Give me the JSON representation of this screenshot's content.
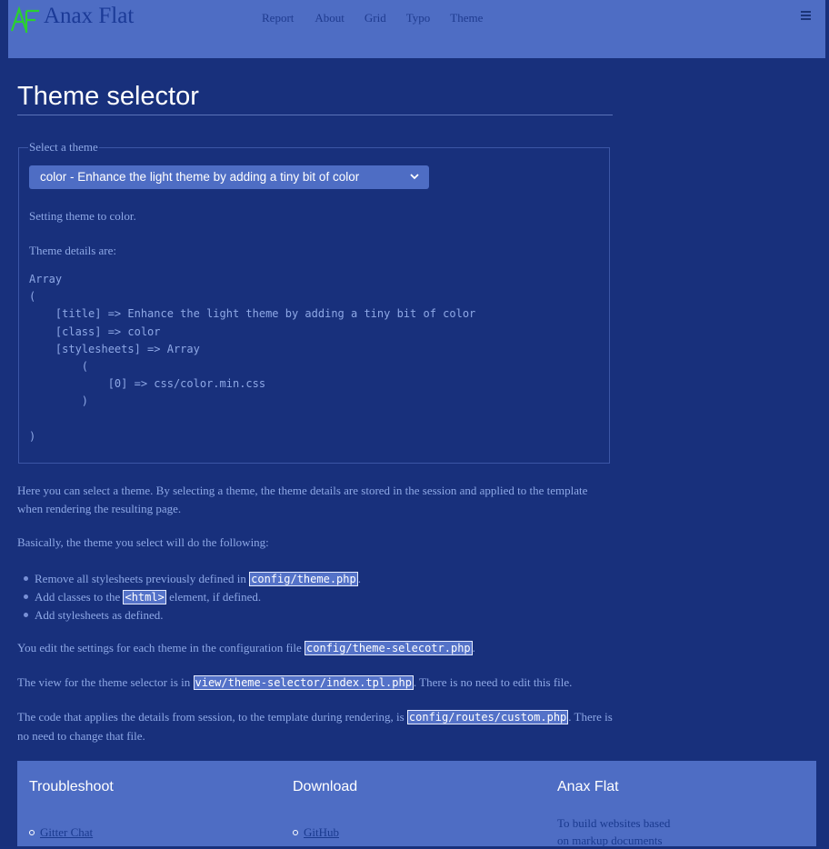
{
  "header": {
    "site_title": "Anax Flat",
    "nav": [
      "Report",
      "About",
      "Grid",
      "Typo",
      "Theme"
    ]
  },
  "main": {
    "title": "Theme selector",
    "legend": "Select a theme",
    "select_value": "color - Enhance the light theme by adding a tiny bit of color",
    "status": "Setting theme to color.",
    "details_label": "Theme details are:",
    "details_code": "Array\n(\n    [title] => Enhance the light theme by adding a tiny bit of color\n    [class] => color\n    [stylesheets] => Array\n        (\n            [0] => css/color.min.css\n        )\n\n)",
    "intro": "Here you can select a theme. By selecting a theme, the theme details are stored in the session and applied to the template when rendering the resulting page.",
    "basically": "Basically, the theme you select will do the following:",
    "steps": [
      {
        "before": "Remove all stylesheets previously defined in ",
        "code": "config/theme.php",
        "after": "."
      },
      {
        "before": "Add classes to the ",
        "code": "<html>",
        "after": " element, if defined."
      },
      {
        "before": "Add stylesheets as defined.",
        "code": "",
        "after": ""
      }
    ],
    "settings": {
      "before": "You edit the settings for each theme in the configuration file ",
      "code": "config/theme-selecotr.php",
      "after": "."
    },
    "view": {
      "before": "The view for the theme selector is in ",
      "code": "view/theme-selector/index.tpl.php",
      "after": ". There is no need to edit this file."
    },
    "routes": {
      "before": "The code that applies the details from session, to the template during rendering, is ",
      "code": "config/routes/custom.php",
      "after": ". There is no need to change that file."
    }
  },
  "footer": {
    "troubleshoot": {
      "title": "Troubleshoot",
      "link": "Gitter Chat"
    },
    "download": {
      "title": "Download",
      "link": "GitHub"
    },
    "about": {
      "title": "Anax Flat",
      "text": "To build websites based on markup documents"
    }
  },
  "colors": {
    "background": "#18307c",
    "header": "#4e6dc4",
    "logo_green": "#2ad12f"
  },
  "icons": [
    "anax-flat-logo",
    "menu-icon",
    "chevron-down-icon"
  ]
}
